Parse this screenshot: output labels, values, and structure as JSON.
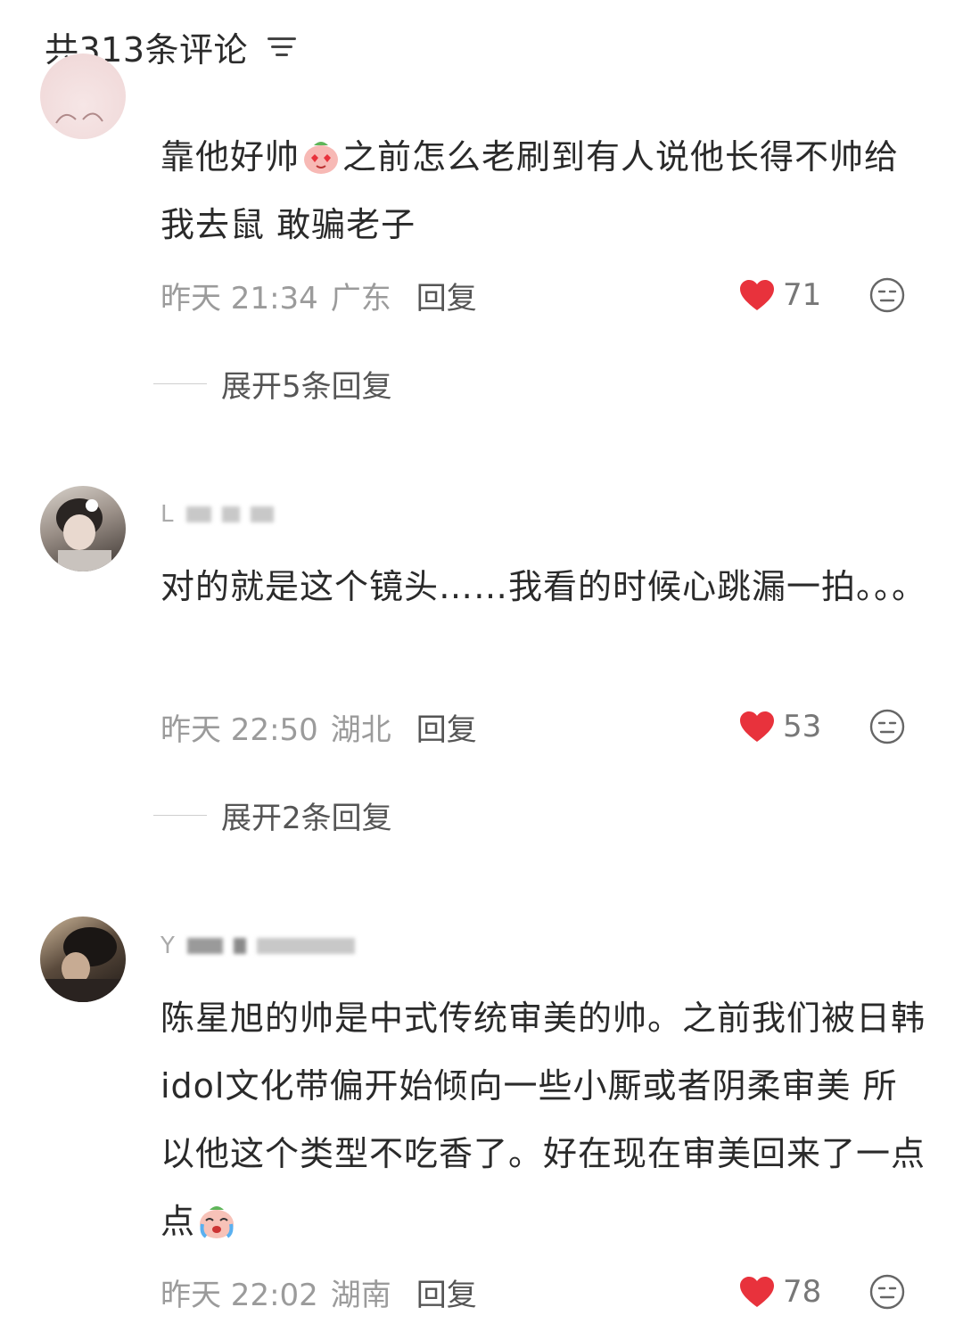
{
  "header": {
    "title": "共313条评论"
  },
  "comments": [
    {
      "username": "",
      "text_before_emoji": "靠他好帅",
      "text_after_emoji": "之前怎么老刷到有人说他长得不帅给我去鼠 敢骗老子",
      "time": "昨天 21:34",
      "location": "广东",
      "reply_label": "回复",
      "likes": "71",
      "expand_label": "展开5条回复"
    },
    {
      "username": "L",
      "text": "对的就是这个镜头……我看的时候心跳漏一拍。。。",
      "time": "昨天 22:50",
      "location": "湖北",
      "reply_label": "回复",
      "likes": "53",
      "expand_label": "展开2条回复"
    },
    {
      "username": "Y",
      "text": "陈星旭的帅是中式传统审美的帅。之前我们被日韩idol文化带偏开始倾向一些小厮或者阴柔审美 所以他这个类型不吃香了。好在现在审美回来了一点点",
      "time": "昨天 22:02",
      "location": "湖南",
      "reply_label": "回复",
      "likes": "78"
    }
  ],
  "colors": {
    "like_heart": "#e8323c",
    "meta_text": "#9b9b9b",
    "body_text": "#2a2a2a"
  }
}
